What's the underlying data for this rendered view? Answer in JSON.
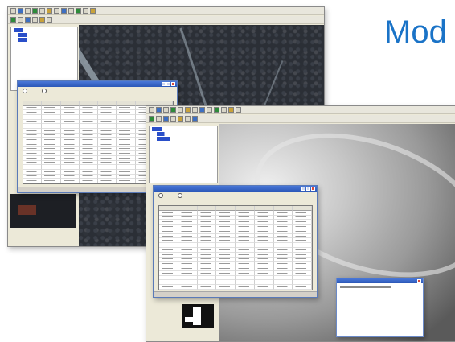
{
  "headline": "Mod",
  "colors": {
    "headline": "#1a73c7",
    "titlebar": "#2c58b8",
    "window_bg": "#ece9d8"
  },
  "icons": [
    "window-icon",
    "toolbar-icon",
    "layer-tree-icon",
    "close-icon"
  ]
}
